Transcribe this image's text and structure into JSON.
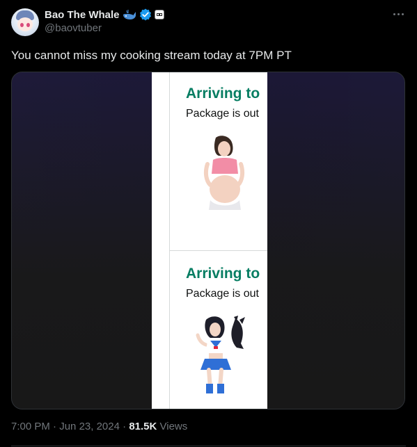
{
  "author": {
    "name": "Bao The Whale",
    "handle": "@baovtuber"
  },
  "tweet": {
    "text": "You cannot miss my cooking stream today at 7PM PT"
  },
  "media": {
    "cards": [
      {
        "title": "Arriving to",
        "subtitle": "Package is out"
      },
      {
        "title": "Arriving to",
        "subtitle": "Package is out"
      }
    ]
  },
  "meta": {
    "time": "7:00 PM",
    "sep1": "·",
    "date": "Jun 23, 2024",
    "sep2": "·",
    "views_count": "81.5K",
    "views_label": "Views"
  },
  "colors": {
    "background": "#000000",
    "text": "#e7e9ea",
    "muted": "#71767b",
    "verified": "#1d9bf0",
    "arriving_green": "#067d62"
  },
  "icons": {
    "whale": "whale-icon",
    "verified": "verified-badge-icon",
    "affiliate": "affiliate-badge-icon",
    "more": "more-icon"
  }
}
